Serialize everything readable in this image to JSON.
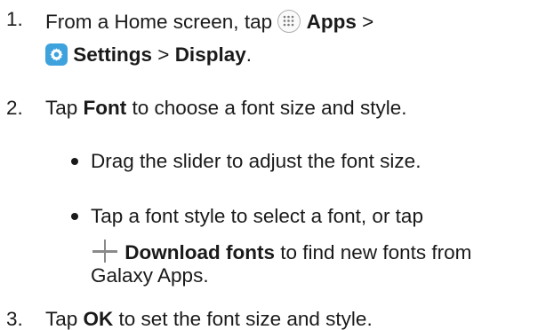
{
  "steps": [
    {
      "number": "1.",
      "line1_a": "From a Home screen, tap ",
      "apps": "Apps",
      "line1_b": " >",
      "settings": "Settings",
      "line2_sep": " > ",
      "display": "Display",
      "line2_end": "."
    },
    {
      "number": "2.",
      "tap": "Tap ",
      "font": "Font",
      "rest": " to choose a font size and style.",
      "bullets": [
        {
          "text": "Drag the slider to adjust the font size."
        },
        {
          "line1": "Tap a font style to select a font, or tap",
          "download": "Download fonts",
          "line2_rest": " to find new fonts from",
          "line3": "Galaxy Apps."
        }
      ]
    },
    {
      "number": "3.",
      "tap": "Tap ",
      "ok": "OK",
      "rest": " to set the font size and style."
    }
  ],
  "icons": {
    "apps": "apps-grid-icon",
    "settings": "gear-icon",
    "download": "plus-icon"
  },
  "colors": {
    "settings_icon_bg": "#3ea2dd",
    "text": "#1a1a1a"
  }
}
